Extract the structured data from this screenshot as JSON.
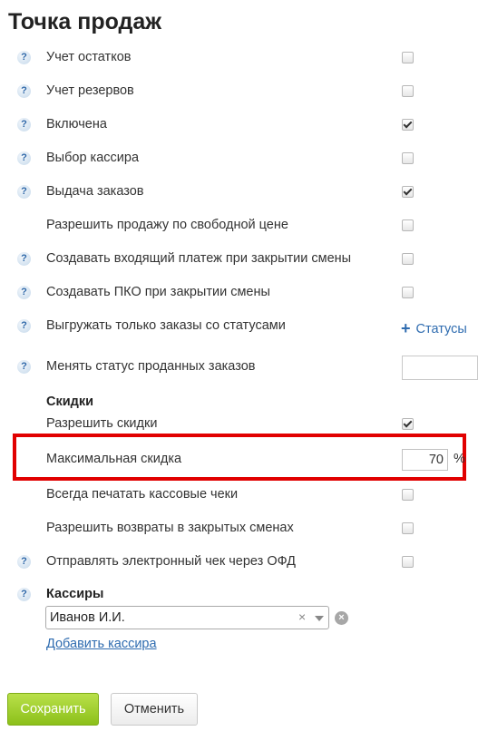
{
  "page": {
    "title": "Точка продаж"
  },
  "settings": [
    {
      "label": "Учет остатков",
      "checked": false
    },
    {
      "label": "Учет резервов",
      "checked": false
    },
    {
      "label": "Включена",
      "checked": true
    },
    {
      "label": "Выбор кассира",
      "checked": false
    },
    {
      "label": "Выдача заказов",
      "checked": true
    },
    {
      "label": "Разрешить продажу по свободной цене",
      "checked": false
    },
    {
      "label": "Создавать входящий платеж при закрытии смены",
      "checked": false
    },
    {
      "label": "Создавать ПКО при закрытии смены",
      "checked": false
    },
    {
      "label": "Выгружать только заказы со статусами",
      "link": "Статусы"
    },
    {
      "label": "Менять статус проданных заказов",
      "value": ""
    }
  ],
  "discounts": {
    "heading": "Скидки",
    "allow_label": "Разрешить скидки",
    "allow_checked": true,
    "max_label": "Максимальная скидка",
    "max_value": "70",
    "unit": "%"
  },
  "more_settings": [
    {
      "label": "Всегда печатать кассовые чеки",
      "checked": false
    },
    {
      "label": "Разрешить возвраты в закрытых сменах",
      "checked": false
    },
    {
      "label": "Отправлять электронный чек через ОФД",
      "checked": false
    }
  ],
  "cashiers": {
    "heading": "Кассиры",
    "selected": "Иванов И.И.",
    "clear_glyph": "×",
    "remove_glyph": "×",
    "add_link": "Добавить кассира"
  },
  "buttons": {
    "save": "Сохранить",
    "cancel": "Отменить"
  },
  "help_glyph": "?",
  "colors": {
    "link": "#2f6cb0",
    "save_button": "#8cc01a",
    "highlight": "#e10000"
  }
}
